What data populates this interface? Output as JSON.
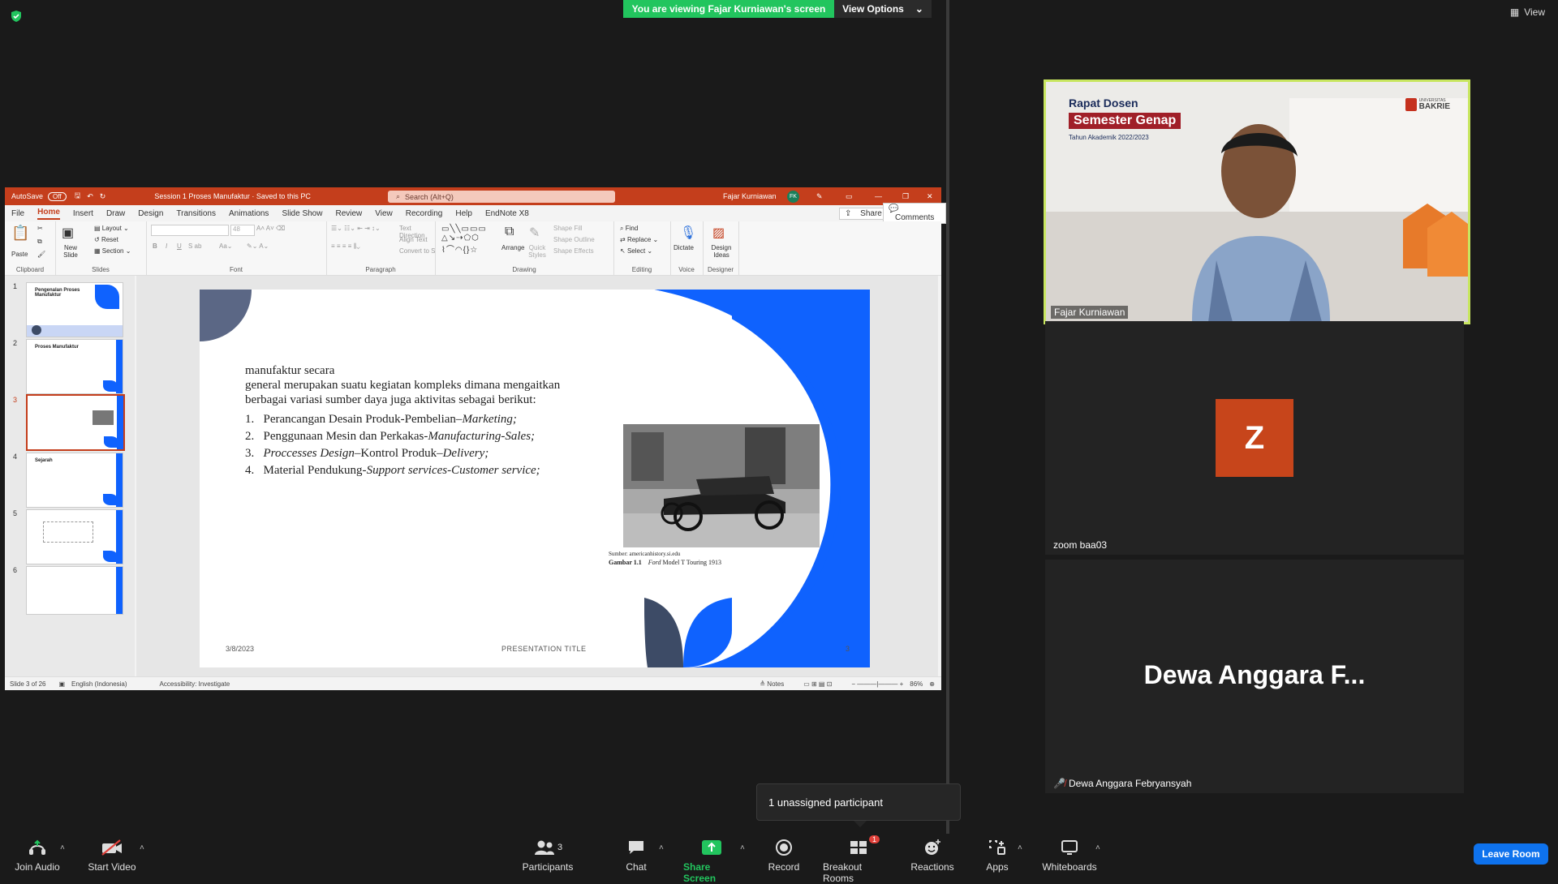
{
  "banner": {
    "viewing_text": "You are viewing Fajar Kurniawan's screen",
    "view_options": "View Options",
    "top_right_view": "View"
  },
  "ppt": {
    "autosave_label": "AutoSave",
    "autosave_state": "Off",
    "doc_title": "Session 1 Proses Manufaktur  ·  Saved to this PC",
    "search_placeholder": "Search (Alt+Q)",
    "user_name": "Fajar Kurniawan",
    "user_initials": "FK",
    "menu": [
      "File",
      "Home",
      "Insert",
      "Draw",
      "Design",
      "Transitions",
      "Animations",
      "Slide Show",
      "Review",
      "View",
      "Recording",
      "Help",
      "EndNote X8"
    ],
    "share_label": "Share",
    "comments_label": "Comments",
    "ribbon": {
      "clipboard": {
        "label": "Clipboard",
        "paste": "Paste"
      },
      "slides": {
        "label": "Slides",
        "new_slide": "New Slide",
        "layout": "Layout",
        "reset": "Reset",
        "section": "Section"
      },
      "font": {
        "label": "Font",
        "size": "48"
      },
      "paragraph": {
        "label": "Paragraph",
        "text_direction": "Text Direction",
        "align_text": "Align Text",
        "smartart": "Convert to SmartArt"
      },
      "drawing": {
        "label": "Drawing",
        "arrange": "Arrange",
        "quick_styles": "Quick Styles",
        "shape_fill": "Shape Fill",
        "shape_outline": "Shape Outline",
        "shape_effects": "Shape Effects"
      },
      "editing": {
        "label": "Editing",
        "find": "Find",
        "replace": "Replace",
        "select": "Select"
      },
      "voice": {
        "label": "Voice",
        "dictate": "Dictate"
      },
      "designer": {
        "label": "Designer",
        "design_ideas": "Design Ideas"
      }
    },
    "thumbnails": [
      {
        "num": "1",
        "title": "Pengenalan Proses Manufaktur"
      },
      {
        "num": "2",
        "title": "Proses Manufaktur"
      },
      {
        "num": "3",
        "title": ""
      },
      {
        "num": "4",
        "title": "Sejarah"
      },
      {
        "num": "5",
        "title": ""
      },
      {
        "num": "6",
        "title": ""
      }
    ],
    "status": {
      "slide_count": "Slide 3 of 26",
      "language": "English (Indonesia)",
      "accessibility": "Accessibility: Investigate",
      "notes": "Notes",
      "zoom": "86%"
    }
  },
  "slide": {
    "intro_line1": "manufaktur secara",
    "intro_line2": "general merupakan suatu kegiatan kompleks dimana mengaitkan",
    "intro_line3": "berbagai variasi sumber daya juga aktivitas sebagai berikut:",
    "items": [
      {
        "num": "1.",
        "plain": "Perancangan Desain Produk-Pembelian–",
        "italic": "Marketing;"
      },
      {
        "num": "2.",
        "plain": "Penggunaan Mesin dan Perkakas-",
        "italic": "Manufacturing-Sales;"
      },
      {
        "num": "3.",
        "italic_pre": "Proccesses Design",
        "plain": "–Kontrol Produk–",
        "italic": "Delivery;"
      },
      {
        "num": "4.",
        "plain": "Material Pendukung-",
        "italic": "Support services-Customer service;"
      }
    ],
    "caption_source": "Sumber: americanhistory.si.edu",
    "caption_label": "Gambar 1.1",
    "caption_italic": "Ford",
    "caption_rest": "Model T Touring 1913",
    "footer_date": "3/8/2023",
    "footer_title": "PRESENTATION TITLE",
    "footer_page": "3"
  },
  "participants": {
    "speaker": {
      "name": "Fajar Kurniawan",
      "banner_line1": "Rapat Dosen",
      "banner_line2": "Semester Genap",
      "banner_line3": "Tahun Akademik 2022/2023",
      "logo_line1": "UNIVERSITAS",
      "logo_line2": "BAKRIE"
    },
    "zoom_tile": {
      "initial": "Z",
      "name": "zoom baa03"
    },
    "dewa_tile": {
      "big_name": "Dewa Anggara F...",
      "name": "Dewa Anggara Febryansyah"
    }
  },
  "popup": {
    "text": "1 unassigned participant"
  },
  "toolbar": {
    "join_audio": "Join Audio",
    "start_video": "Start Video",
    "participants": "Participants",
    "participants_count": "3",
    "chat": "Chat",
    "share_screen": "Share Screen",
    "record": "Record",
    "breakout": "Breakout Rooms",
    "breakout_badge": "1",
    "reactions": "Reactions",
    "apps": "Apps",
    "whiteboards": "Whiteboards",
    "leave": "Leave Room"
  },
  "colors": {
    "ppt_accent": "#c43e1c",
    "slide_blue": "#0f62fe",
    "slide_navy": "#3d4b66",
    "zoom_green": "#22c55e",
    "leave_blue": "#0e72ed",
    "z_tile": "#c7451b"
  }
}
